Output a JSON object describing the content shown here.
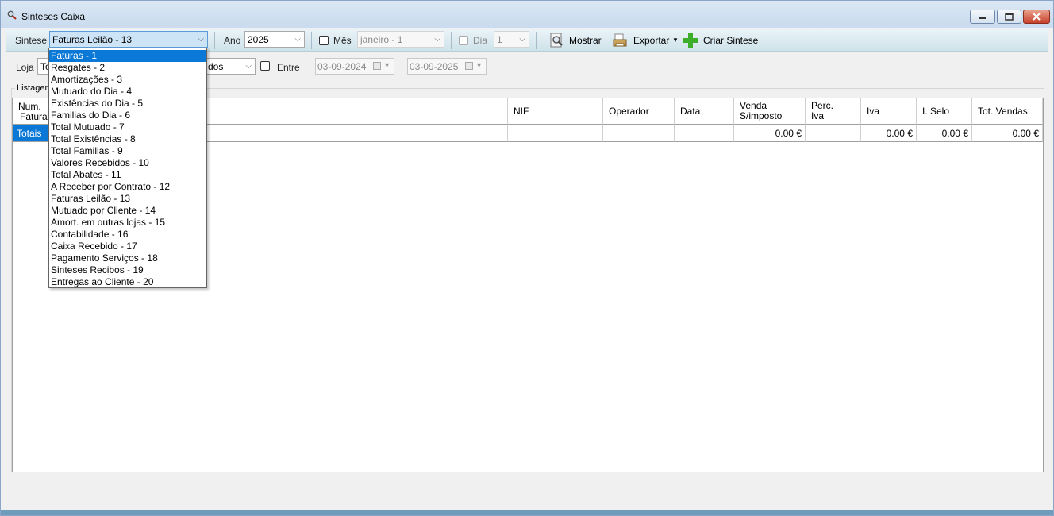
{
  "window": {
    "title": "Sinteses Caixa",
    "minimize_glyph": "—",
    "maximize_glyph": "▢",
    "close_glyph": "✕"
  },
  "toolbar": {
    "sintese_label": "Sintese",
    "sintese_value": "Faturas Leilão - 13",
    "ano_label": "Ano",
    "ano_value": "2025",
    "mes_label": "Mês",
    "mes_value": "janeiro - 1",
    "dia_label": "Dia",
    "dia_value": "1",
    "mostrar_label": "Mostrar",
    "exportar_label": "Exportar",
    "criar_label": "Criar Sintese"
  },
  "filters": {
    "loja_label": "Loja",
    "loja_value_visible_start": "To",
    "loja_value_visible_end": "dos",
    "entre_label": "Entre",
    "date_from": "03-09-2024",
    "date_to": "03-09-2025"
  },
  "group": {
    "title": "Listagem"
  },
  "grid": {
    "headers": [
      [
        "Num.",
        "Fatura"
      ],
      [
        "",
        ""
      ],
      [
        "NIF",
        ""
      ],
      [
        "Operador",
        ""
      ],
      [
        "Data",
        ""
      ],
      [
        "Venda",
        "S/imposto"
      ],
      [
        "Perc.",
        "Iva"
      ],
      [
        "Iva",
        ""
      ],
      [
        "I. Selo",
        ""
      ],
      [
        "Tot. Vendas",
        ""
      ]
    ],
    "totals_row": [
      "Totais",
      "",
      "",
      "",
      "",
      "0.00 €",
      "",
      "0.00 €",
      "0.00 €",
      "0.00 €"
    ]
  },
  "dropdown": {
    "highlighted_index": 0,
    "items": [
      "Faturas - 1",
      "Resgates - 2",
      "Amortizações - 3",
      "Mutuado do Dia - 4",
      "Existências do Dia - 5",
      "Familias do Dia - 6",
      "Total Mutuado - 7",
      "Total Existências - 8",
      "Total Familias - 9",
      "Valores Recebidos - 10",
      "Total Abates - 11",
      "A Receber por Contrato - 12",
      "Faturas Leilão - 13",
      "Mutuado por Cliente - 14",
      "Amort. em outras lojas - 15",
      "Contabilidade - 16",
      "Caixa Recebido - 17",
      "Pagamento Serviços - 18",
      "Sinteses Recibos - 19",
      "Entregas ao Cliente - 20"
    ]
  },
  "icons": {
    "app": "magnifier-icon",
    "mostrar": "magnifier-document-icon",
    "exportar": "export-printer-icon",
    "criar": "green-plus-icon"
  },
  "colors": {
    "selection": "#0a78d7",
    "toolbar_top": "#eaf3f8",
    "toolbar_bottom": "#cfe3ea",
    "plus_green": "#3cae2c"
  }
}
